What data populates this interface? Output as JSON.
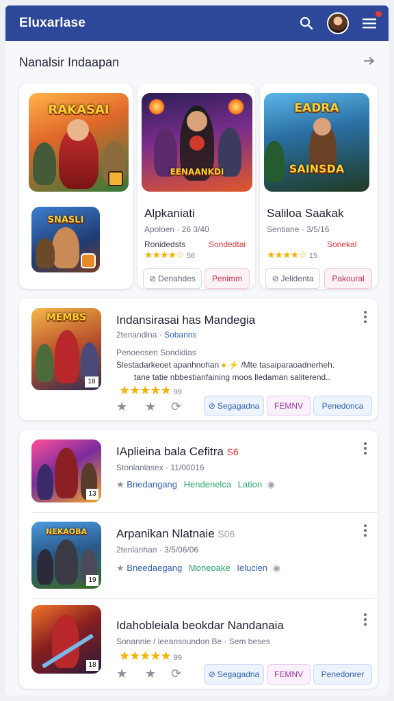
{
  "app": {
    "title": "Eluxarlase"
  },
  "colors": {
    "header": "#2d4799",
    "star": "#f5b301",
    "accent_red": "#d8343c",
    "accent_blue": "#3361b8",
    "accent_green": "#28a56b"
  },
  "header": {
    "icons": [
      "search-icon",
      "avatar",
      "menu-icon"
    ]
  },
  "featured": {
    "title": "Nanalsir Indaapan",
    "items": [
      {
        "art_text": "RAKASAI",
        "art_text2": ""
      },
      {
        "art_text": "SNASLI",
        "art_text2": ""
      },
      {
        "title": "Alpkaniati",
        "meta": "Apoloen · 26 3/40",
        "status": "Ronidedsts",
        "status2": "Sondedtai",
        "rating_count": "56",
        "btn1": "Denahdes",
        "btn2": "Penimm",
        "art_text": "EENAANKDI"
      },
      {
        "title": "Saliloa Saakak",
        "meta": "Sentiane · 3/5/16",
        "status": "Sonekal",
        "rating_count": "15",
        "btn1": "Jelidenta",
        "btn2": "Pakoural",
        "art_text": "EADRA",
        "art_text2": "SAINSDA"
      }
    ]
  },
  "list": [
    {
      "title": "Indansirasai has Mandegia",
      "meta": "2tenandina · ",
      "meta_link": "Sobanns",
      "desc1": "Penoeosen Sondidias",
      "desc2": "Slestadarkeoet apanhnohan",
      "desc2b": "/Mte tasaiparaoadnerheh.",
      "desc3": "tane tatie nbbestianfaining moos lledaman saliterend..",
      "rating_count": "99",
      "btn1": "Segagadna",
      "btn2": "FEMNV",
      "btn3": "Penedonca",
      "art_text": "MEMBS",
      "badge": "18"
    },
    {
      "title": "IAplieina bala Cefitra",
      "title_badge": "S6",
      "meta": "Stonlanlasex · 11/00016",
      "tags": [
        "Bnedangang",
        "Hendenelca",
        "Lation"
      ],
      "art_text": "",
      "badge": "13"
    },
    {
      "title": "Arpanikan Nlatnaie",
      "title_badge": "S06",
      "meta": "2tenlanhan · 3/5/06/06",
      "tags": [
        "Bneedaegang",
        "Moneoake",
        "Ielucien"
      ],
      "art_text": "NEKAOBA",
      "badge": "19"
    },
    {
      "title": "Idahobleiala beokdar Nandanaia",
      "meta": "Sonannie / leeansoundon Be · Sem beses",
      "rating_count": "99",
      "btn1": "Segagadna",
      "btn2": "FEMNV",
      "btn3": "Penedonrer",
      "art_text": "",
      "badge": "18"
    }
  ]
}
